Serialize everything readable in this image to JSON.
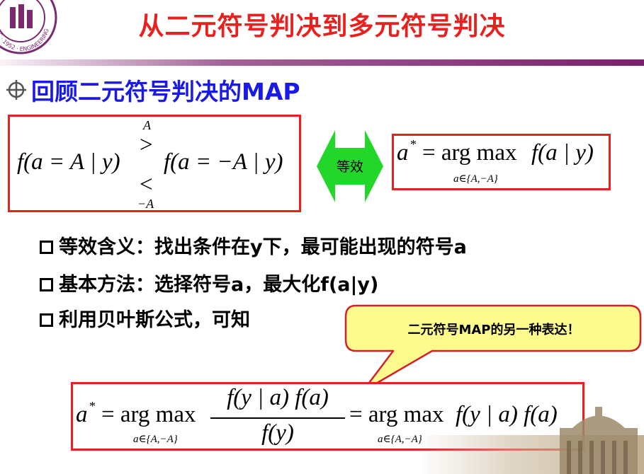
{
  "header": {
    "title": "从二元符号判决到多元符号判决",
    "logo_text": "NIC · 1952 · ENGINEERING"
  },
  "section": {
    "heading": "回顾二元符号判决的MAP"
  },
  "formula_binary": {
    "lhs": "f(a = A | y)",
    "upper_label": "A",
    "greater": ">",
    "less": "<",
    "lower_label": "−A",
    "rhs": "f(a = −A | y)"
  },
  "equivalence_label": "等效",
  "formula_argmax": {
    "lhs": "a",
    "star": "*",
    "eq": "= arg max",
    "argument": "f(a | y)",
    "subscript": "a∈{A,−A}"
  },
  "bullets": [
    {
      "text": "等效含义：找出条件在y下，最可能出现的符号a"
    },
    {
      "text": "基本方法：选择符号a，最大化f(a|y)"
    },
    {
      "text": "利用贝叶斯公式，可知"
    }
  ],
  "callout": {
    "text": "二元符号MAP的另一种表达！"
  },
  "formula_bayes": {
    "lhs": "a",
    "star": "*",
    "eq1": "= arg max",
    "subscript1": "a∈{A,−A}",
    "numerator": "f(y | a) f(a)",
    "denominator": "f(y)",
    "eq2": "= arg max",
    "subscript2": "a∈{A,−A}",
    "rhs": "f(y | a) f(a)"
  },
  "colors": {
    "title_red": "#e8211e",
    "heading_blue": "#1a1ae6",
    "box_red": "#e8211e",
    "arrow_green": "#22d62a",
    "callout_fill": "#fdfa8e",
    "callout_border": "#d4202a",
    "header_rule": "#7a1f6b"
  }
}
